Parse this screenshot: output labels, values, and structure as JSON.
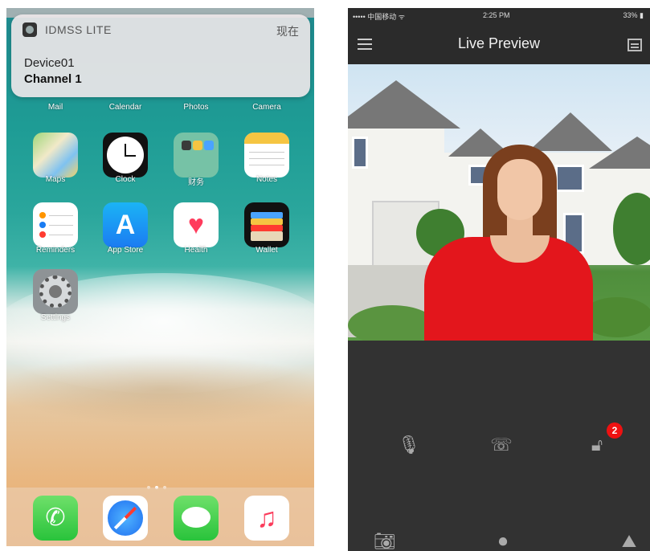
{
  "left_phone": {
    "notification": {
      "app_name": "IDMSS LITE",
      "time": "现在",
      "title": "Device01",
      "body": "Channel 1"
    },
    "row0_labels": [
      "Mail",
      "Calendar",
      "Photos",
      "Camera"
    ],
    "apps": [
      {
        "name": "Maps"
      },
      {
        "name": "Clock"
      },
      {
        "name": "财务"
      },
      {
        "name": "Notes"
      },
      {
        "name": "Reminders"
      },
      {
        "name": "App Store"
      },
      {
        "name": "Health"
      },
      {
        "name": "Wallet"
      },
      {
        "name": "Settings"
      }
    ],
    "dock": [
      "phone-icon",
      "safari-icon",
      "messages-icon",
      "music-icon"
    ]
  },
  "right_phone": {
    "status": {
      "carrier": "••••• 中国移动 ᯤ",
      "time": "2:25 PM",
      "battery": "33% ▮"
    },
    "title": "Live Preview",
    "lock_badge": "2",
    "icons": [
      "menu-icon",
      "split-screen-icon",
      "microphone-icon",
      "talk-icon",
      "unlock-icon",
      "snapshot-icon",
      "record-icon",
      "image-icon"
    ]
  }
}
